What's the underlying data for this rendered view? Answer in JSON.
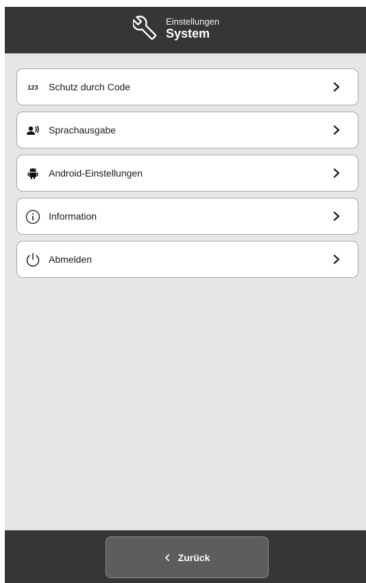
{
  "header": {
    "icon": "wrench-icon",
    "subtitle": "Einstellungen",
    "title": "System"
  },
  "menu": {
    "items": [
      {
        "icon": "numeric-123-icon",
        "icon_text": "123",
        "label": "Schutz durch Code"
      },
      {
        "icon": "voice-speaker-icon",
        "label": "Sprachausgabe"
      },
      {
        "icon": "android-icon",
        "label": "Android-Einstellungen"
      },
      {
        "icon": "info-circle-icon",
        "label": "Information"
      },
      {
        "icon": "power-icon",
        "label": "Abmelden"
      }
    ]
  },
  "footer": {
    "back_label": "Zurück",
    "back_icon": "chevron-left-icon"
  },
  "colors": {
    "header_bg": "#363636",
    "content_bg": "#e6e6e6",
    "item_bg": "#ffffff",
    "item_border": "#a9a9a9",
    "back_button_bg": "#5d5d5d"
  }
}
